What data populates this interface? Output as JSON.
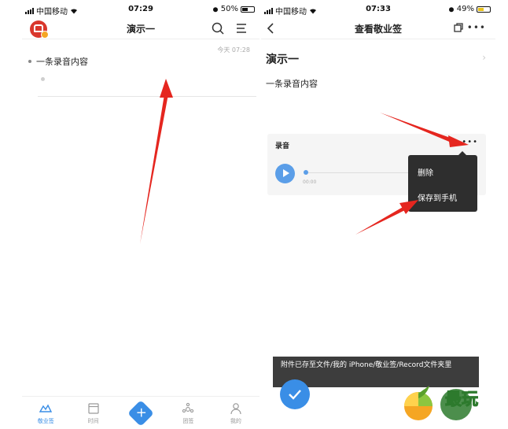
{
  "colors": {
    "accent": "#3a8ee6",
    "arrow": "#e5261f",
    "popup_bg": "#2e2e2e",
    "toast_bg": "#333333"
  },
  "left_screen": {
    "status_bar": {
      "carrier": "中国移动",
      "time": "07:29",
      "battery": "50%",
      "battery_level": 0.5
    },
    "nav": {
      "title": "演示一",
      "avatar_icon": "avatar-icon",
      "search_icon": "search-icon",
      "menu_icon": "menu-icon"
    },
    "note": {
      "timestamp": "今天 07:28",
      "text": "一条录音内容"
    },
    "tabbar": [
      {
        "label": "敬业签",
        "icon": "notes-icon",
        "active": true
      },
      {
        "label": "时间",
        "icon": "calendar-icon",
        "active": false
      },
      {
        "label": "",
        "icon": "add-icon",
        "active": false
      },
      {
        "label": "团签",
        "icon": "group-icon",
        "active": false
      },
      {
        "label": "我的",
        "icon": "user-icon",
        "active": false
      }
    ]
  },
  "right_screen": {
    "status_bar": {
      "carrier": "中国移动",
      "time": "07:33",
      "battery": "49%",
      "battery_level": 0.49
    },
    "nav": {
      "title": "查看敬业签",
      "back_icon": "back-icon",
      "copy_icon": "copy-icon",
      "more_label": "•••"
    },
    "detail": {
      "title": "演示一",
      "content": "一条录音内容"
    },
    "recording": {
      "label": "录音",
      "more_label": "•••",
      "time": "00:00",
      "progress": 0
    },
    "popup_menu": {
      "items": [
        "删除",
        "保存到手机"
      ]
    },
    "toast": "附件已存至文件/我的 iPhone/敬业签/Record文件夹里",
    "watermark": "最玩"
  }
}
